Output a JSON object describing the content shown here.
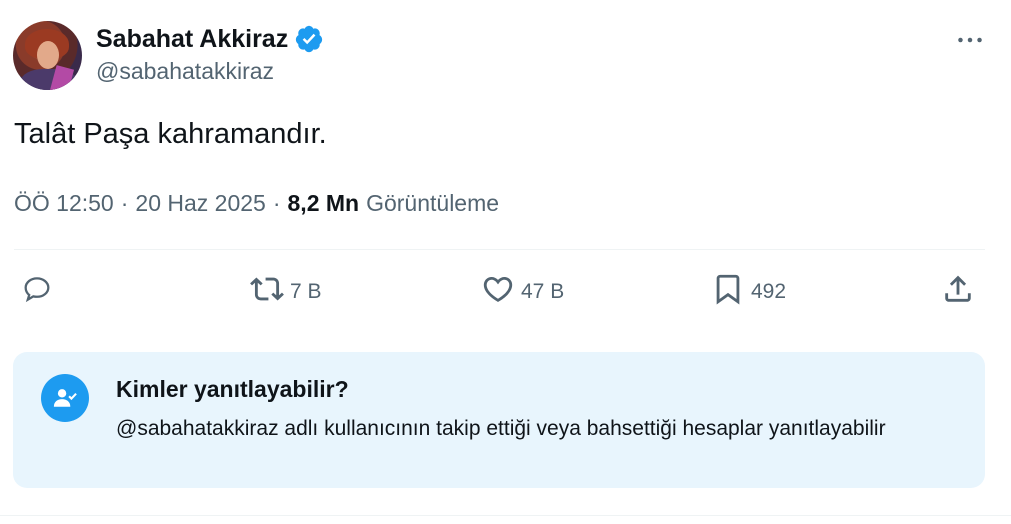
{
  "author": {
    "display_name": "Sabahat Akkiraz",
    "handle": "@sabahatakkiraz",
    "verified": true
  },
  "tweet": {
    "text": "Talât Paşa kahramandır.",
    "time": "ÖÖ 12:50",
    "separator": "·",
    "date": "20 Haz 2025",
    "views_count": "8,2 Mn",
    "views_label": "Görüntüleme"
  },
  "actions": {
    "reply_count": "",
    "retweet_count": "7 B",
    "like_count": "47 B",
    "bookmark_count": "492"
  },
  "reply_settings": {
    "title": "Kimler yanıtlayabilir?",
    "description": "@sabahatakkiraz adlı kullanıcının takip ettiği veya bahsettiği hesaplar yanıtlayabilir"
  },
  "colors": {
    "accent": "#1d9bf0",
    "muted_text": "#536471",
    "primary_text": "#0f1419",
    "reply_box_bg": "#e8f5fd"
  },
  "icons": [
    "verified-badge-icon",
    "more-icon",
    "reply-icon",
    "retweet-icon",
    "like-icon",
    "bookmark-icon",
    "share-icon",
    "user-check-icon"
  ]
}
